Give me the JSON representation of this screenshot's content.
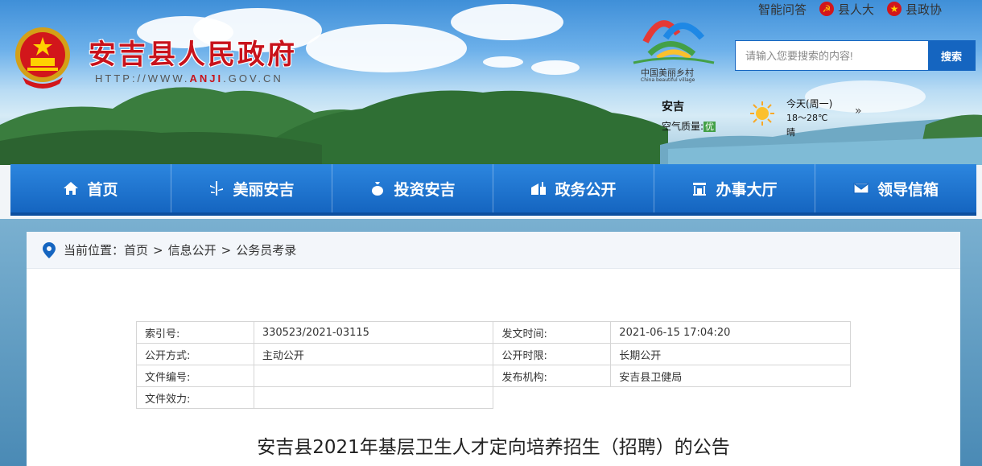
{
  "site": {
    "title": "安吉县人民政府",
    "url_prefix": "HTTP://WWW.",
    "url_brand": "ANJI",
    "url_suffix": ".GOV.CN"
  },
  "top_links": [
    {
      "label": "智能问答",
      "icon": ""
    },
    {
      "label": "县人大",
      "icon": "party-emblem-icon"
    },
    {
      "label": "县政协",
      "icon": "cppcc-emblem-icon"
    }
  ],
  "village_logo": {
    "text": "中国美丽乡村",
    "sub": "China beautiful village"
  },
  "search": {
    "placeholder": "请输入您要搜索的内容!",
    "button": "搜索"
  },
  "weather": {
    "city": "安吉",
    "air_label": "空气质量:",
    "air_value": "优",
    "today": "今天(周一)",
    "temp": "18～28℃",
    "condition": "晴",
    "more": "»"
  },
  "nav": [
    {
      "label": "首页",
      "icon": "home-icon"
    },
    {
      "label": "美丽安吉",
      "icon": "bamboo-icon"
    },
    {
      "label": "投资安吉",
      "icon": "money-bag-icon"
    },
    {
      "label": "政务公开",
      "icon": "building-icon"
    },
    {
      "label": "办事大厅",
      "icon": "hall-icon"
    },
    {
      "label": "领导信箱",
      "icon": "mail-icon"
    }
  ],
  "breadcrumb": {
    "prefix": "当前位置：",
    "items": [
      "首页",
      "信息公开",
      "公务员考录"
    ],
    "separator": ">"
  },
  "meta": {
    "index_no_label": "索引号:",
    "index_no": "330523/2021-03115",
    "publish_time_label": "发文时间:",
    "publish_time": "2021-06-15 17:04:20",
    "open_mode_label": "公开方式:",
    "open_mode": "主动公开",
    "open_period_label": "公开时限:",
    "open_period": "长期公开",
    "doc_no_label": "文件编号:",
    "doc_no": "",
    "issuer_label": "发布机构:",
    "issuer": "安吉县卫健局",
    "validity_label": "文件效力:",
    "validity": ""
  },
  "article": {
    "title": "安吉县2021年基层卫生人才定向培养招生（招聘）的公告"
  },
  "colors": {
    "brand_red": "#c8121b",
    "nav_blue": "#1565c0"
  }
}
